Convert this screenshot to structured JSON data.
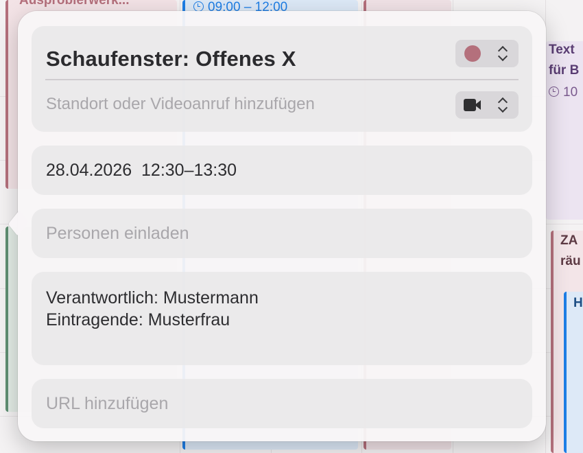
{
  "background": {
    "events": [
      {
        "title": "Ausprobierwerk...",
        "color": "#b4707c"
      },
      {
        "time": "09:00 – 12:00",
        "color": "#1e7ee6"
      },
      {
        "title": "Text",
        "title2": "für B",
        "time": "10",
        "color": "#7a5a8e"
      },
      {
        "title": "ZA",
        "title2": "räu",
        "color": "#b4707c"
      },
      {
        "title": "H",
        "color": "#1e7ee6"
      }
    ]
  },
  "popover": {
    "title": "Schaufenster: Offenes X",
    "calendar_color": "#b4707c",
    "calendar_color_icon": "circle",
    "location_placeholder": "Standort oder Videoanruf hinzufügen",
    "video_icon": "video-camera",
    "datetime": "28.04.2026  12:30–13:30",
    "invitees_placeholder": "Personen einladen",
    "notes": {
      "line1": "Verantwortlich: Mustermann",
      "line2": "Eintragende: Musterfrau"
    },
    "url_placeholder": "URL hinzufügen"
  }
}
